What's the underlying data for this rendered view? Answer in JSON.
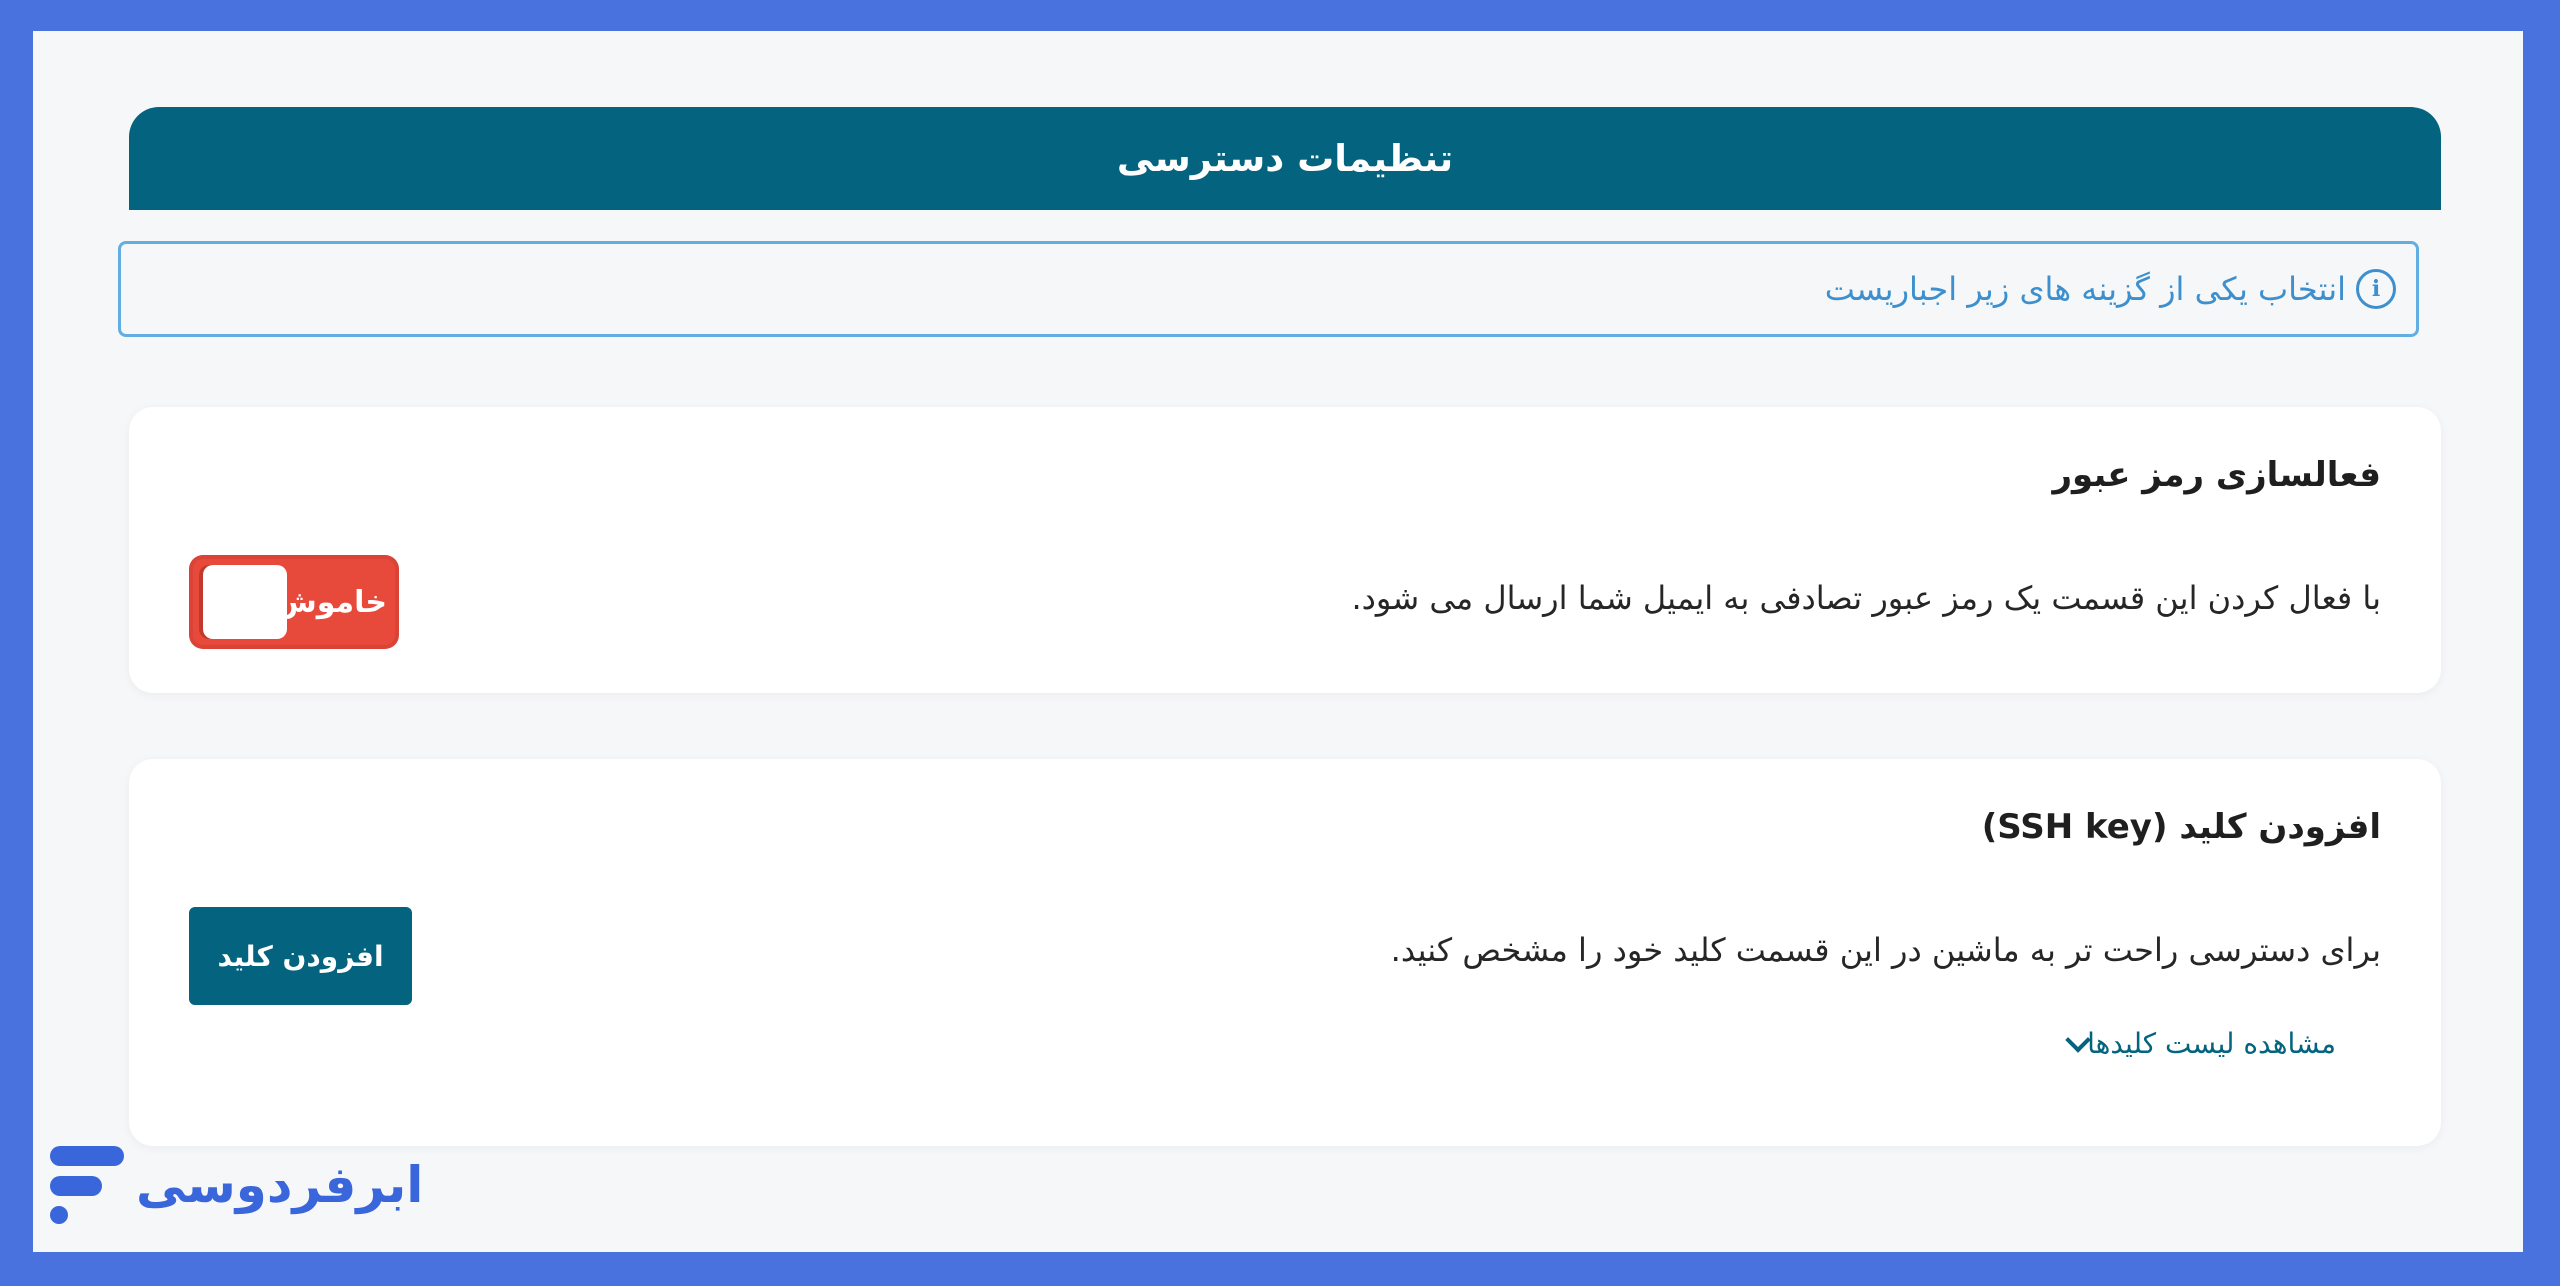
{
  "header": {
    "title": "تنظیمات دسترسی"
  },
  "notice": {
    "icon": "info-icon",
    "icon_glyph": "i",
    "text": "انتخاب یکی از گزینه های زیر اجباریست"
  },
  "password_card": {
    "title": "فعالسازی رمز عبور",
    "description": "با فعال کردن این قسمت یک رمز عبور تصادفی به ایمیل شما ارسال می شود.",
    "toggle_label": "خاموش",
    "toggle_state": "off",
    "toggle_color": "#e74a3b"
  },
  "ssh_card": {
    "title": "افزودن کلید (SSH key)",
    "description": "برای دسترسی راحت تر به ماشین در این قسمت کلید خود را مشخص کنید.",
    "add_button_label": "افزودن کلید",
    "list_toggle_label": "مشاهده لیست کلیدها",
    "list_toggle_icon": "chevron-down-icon"
  },
  "brand": {
    "name": "ابرفردوسی",
    "logo_icon": "brand-logo-icon"
  },
  "colors": {
    "primary": "#04637e",
    "accent_blue": "#3d8fcd",
    "outer_border": "#4a72de",
    "brand": "#3a66dc"
  }
}
